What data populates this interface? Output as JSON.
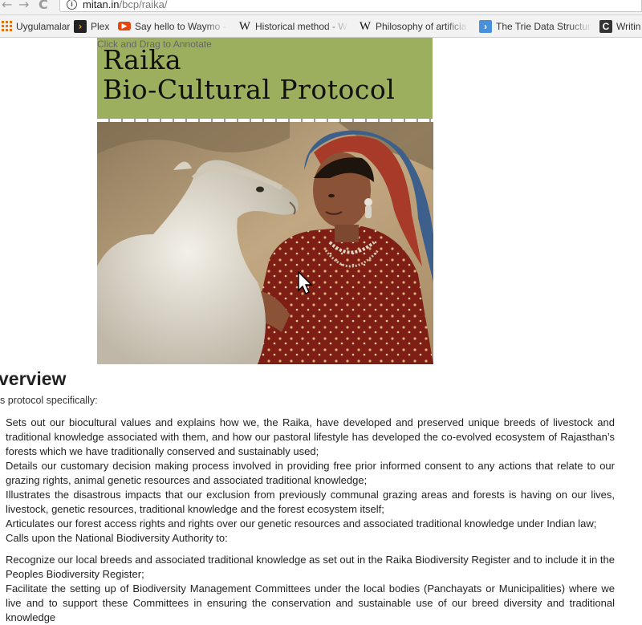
{
  "browser": {
    "nav": {
      "back": "←",
      "forward": "→",
      "reload": "C"
    },
    "url": {
      "host": "mitan.in",
      "path": "/bcp/raika/"
    },
    "bookmarks": [
      {
        "label": "Uygulamalar",
        "icon": "apps-grid-icon"
      },
      {
        "label": "Plex",
        "icon": "plex-icon"
      },
      {
        "label": "Say hello to Waymo -",
        "icon": "youtube-icon"
      },
      {
        "label": "Historical method - W",
        "icon": "wikipedia-icon"
      },
      {
        "label": "Philosophy of artificia",
        "icon": "wikipedia-icon"
      },
      {
        "label": "The Trie Data Structur",
        "icon": "trie-site-icon"
      },
      {
        "label": "Writin",
        "icon": "writing-site-icon"
      }
    ]
  },
  "page": {
    "annotate_hint": "Click and Drag to Annotate",
    "banner": {
      "line1": "Raika",
      "line2": "Bio-Cultural Protocol",
      "color": "#9caf5f"
    },
    "overview": {
      "heading": "verview",
      "intro": "s protocol specifically:",
      "points": [
        "Sets out our biocultural values and explains how we, the Raika, have developed and preserved unique breeds of livestock and traditional knowledge associated with them, and how our pastoral lifestyle has developed the co-evolved ecosystem of Rajasthan’s forests which we have traditionally conserved and sustainably used;",
        "Details our customary decision making process involved in providing free prior informed consent to any actions that relate to our grazing rights, animal genetic resources and associated traditional knowledge;",
        "Illustrates the disastrous impacts that our exclusion from previously communal grazing areas and forests is having on our lives, livestock, genetic resources, traditional knowledge and the forest ecosystem itself;",
        "Articulates our forest access rights and rights over our genetic resources and associated traditional knowledge under Indian law;",
        "Calls upon the National Biodiversity Authority to:"
      ],
      "subpoints": [
        "Recognize our local breeds and associated traditional knowledge as set out in the Raika Biodiversity Register and to include it in the Peoples Biodiversity Register;",
        "Facilitate the setting up of Biodiversity Management Committees under the local bodies (Panchayats or Municipalities) where we live and to support these Committees in ensuring the conservation and sustainable use of our breed diversity and traditional knowledge"
      ]
    }
  }
}
